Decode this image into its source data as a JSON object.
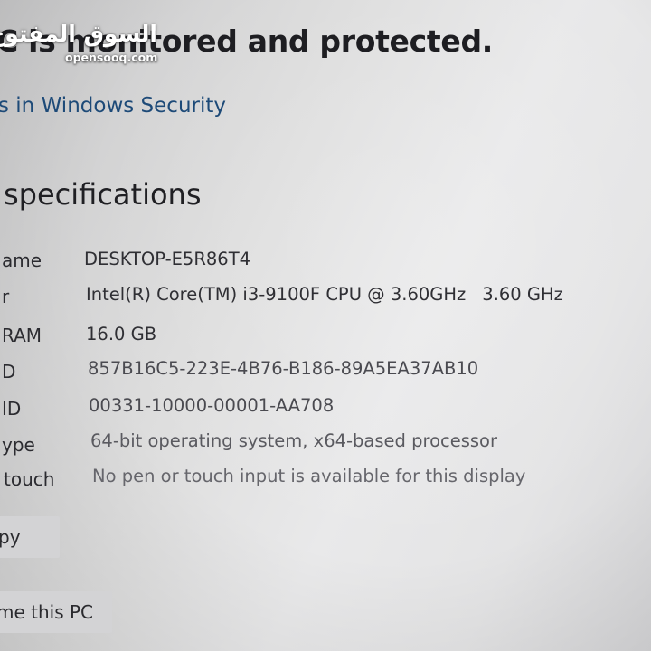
{
  "security": {
    "headline": "C is monitored and protected.",
    "link": "s in Windows Security"
  },
  "specs": {
    "title": "specifications",
    "rows": [
      {
        "label": "ame",
        "value": "DESKTOP-E5R86T4"
      },
      {
        "label": "r",
        "value": "Intel(R) Core(TM) i3-9100F CPU @ 3.60GHz",
        "extra": "3.60 GHz"
      },
      {
        "label": "RAM",
        "value": "16.0 GB"
      },
      {
        "label": "D",
        "value": "857B16C5-223E-4B76-B186-89A5EA37AB10"
      },
      {
        "label": "ID",
        "value": "00331-10000-00001-AA708"
      },
      {
        "label": "ype",
        "value": "64-bit operating system, x64-based processor"
      },
      {
        "label": "touch",
        "value": "No pen or touch input is available for this display"
      }
    ],
    "copy_button": "py",
    "rename_button": "me this PC"
  },
  "watermark": {
    "arabic": "السوق المفتوح",
    "latin": "opensooq.com"
  }
}
